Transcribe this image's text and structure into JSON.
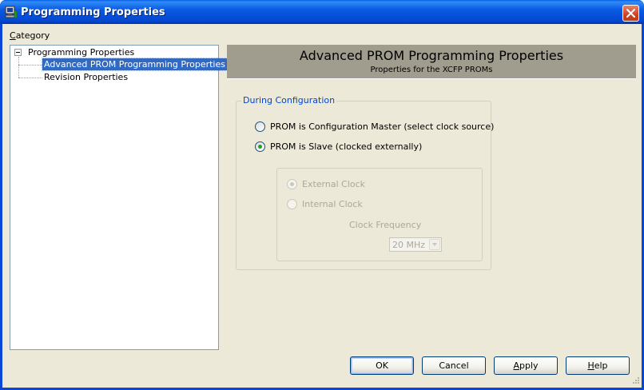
{
  "window": {
    "title": "Programming Properties",
    "icon": "programmer-app-icon",
    "close_icon": "close-x-icon"
  },
  "category": {
    "label_prefix": "C",
    "label_rest": "ategory",
    "tree": {
      "root": "Programming Properties",
      "children": [
        "Advanced PROM Programming Properties",
        "Revision Properties"
      ],
      "selected": "Advanced PROM Programming Properties"
    }
  },
  "banner": {
    "title": "Advanced PROM Programming Properties",
    "subtitle": "Properties for the XCFP PROMs"
  },
  "during_config": {
    "caption": "During Configuration",
    "options": [
      {
        "label": "PROM is Configuration Master (select clock source)",
        "checked": false
      },
      {
        "label": "PROM is Slave (clocked externally)",
        "checked": true
      }
    ],
    "clock": {
      "options": [
        {
          "label": "External Clock",
          "checked": true
        },
        {
          "label": "Internal Clock",
          "checked": false
        }
      ],
      "frequency_label": "Clock Frequency",
      "frequency_value": "20 MHz"
    }
  },
  "buttons": {
    "ok": "OK",
    "cancel": "Cancel",
    "apply_prefix": "A",
    "apply_rest": "pply",
    "help_prefix": "H",
    "help_rest": "elp"
  },
  "colors": {
    "titlebar": "#0a5ae4",
    "dialog_bg": "#ece9d8",
    "selection": "#316ac5",
    "group_caption": "#0046d5",
    "banner_bg": "#a09d8e"
  }
}
